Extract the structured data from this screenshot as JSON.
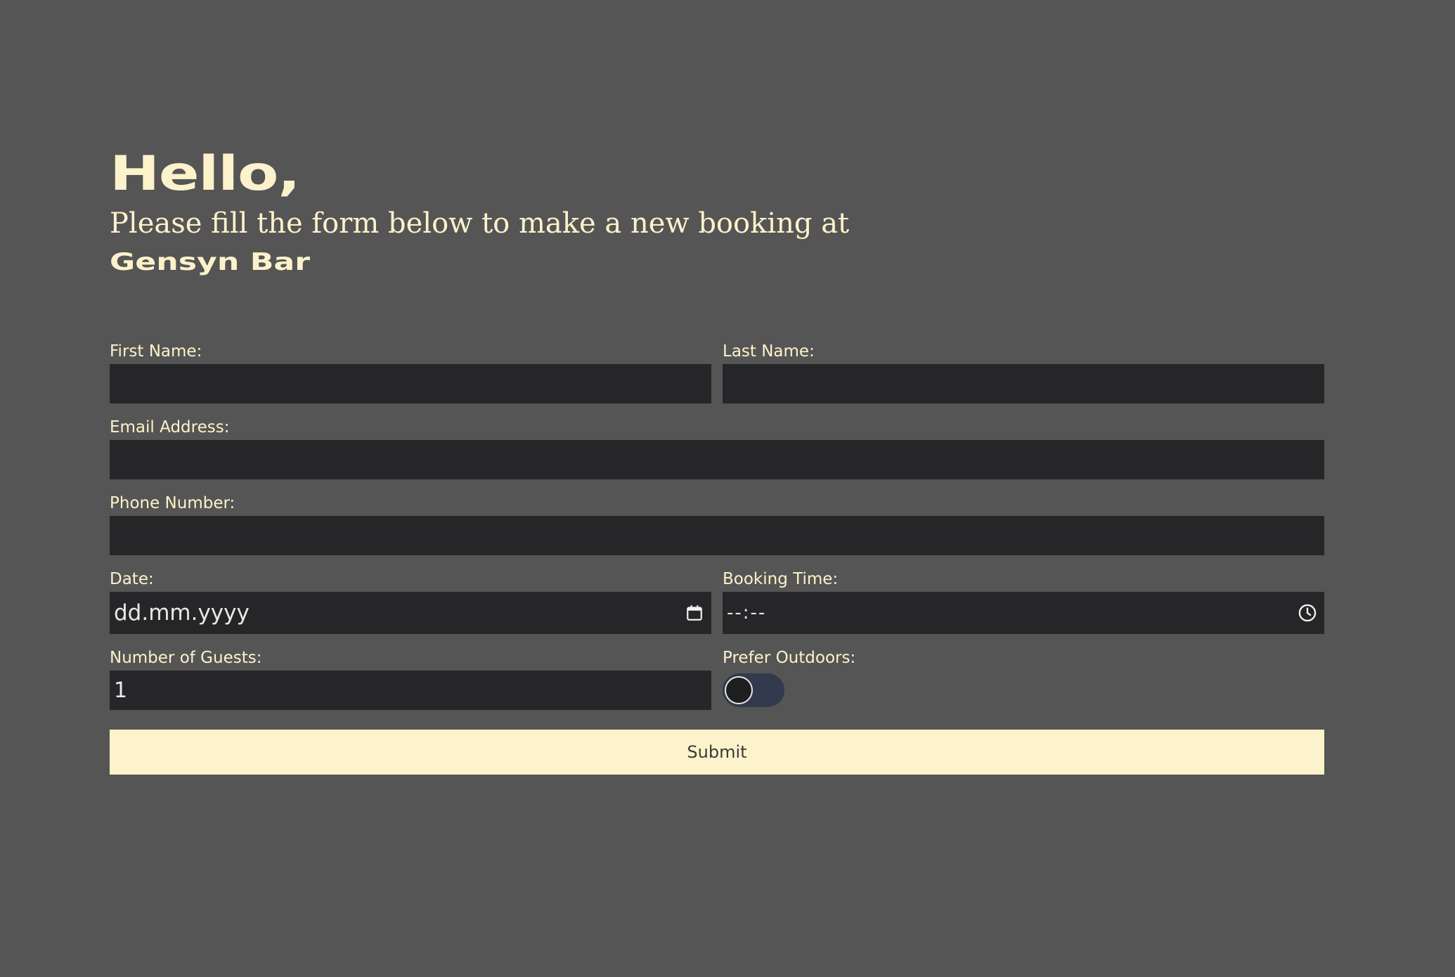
{
  "header": {
    "greeting": "Hello,",
    "subtitle": "Please fill the form below to make a new booking at",
    "venue": "Gensyn Bar"
  },
  "form": {
    "first_name": {
      "label": "First Name:",
      "value": ""
    },
    "last_name": {
      "label": "Last Name:",
      "value": ""
    },
    "email": {
      "label": "Email Address:",
      "value": ""
    },
    "phone": {
      "label": "Phone Number:",
      "value": ""
    },
    "date": {
      "label": "Date:",
      "placeholder": "dd.mm.yyyy",
      "icon": "calendar-icon"
    },
    "time": {
      "label": "Booking Time:",
      "placeholder": "--:--",
      "icon": "clock-icon"
    },
    "guests": {
      "label": "Number of Guests:",
      "value": "1"
    },
    "outdoors": {
      "label": "Prefer Outdoors:",
      "checked": false
    },
    "submit_label": "Submit"
  },
  "colors": {
    "background": "#555555",
    "accent": "#FCF2CB",
    "input_bg": "#262628",
    "toggle_bg": "#323A4E"
  }
}
